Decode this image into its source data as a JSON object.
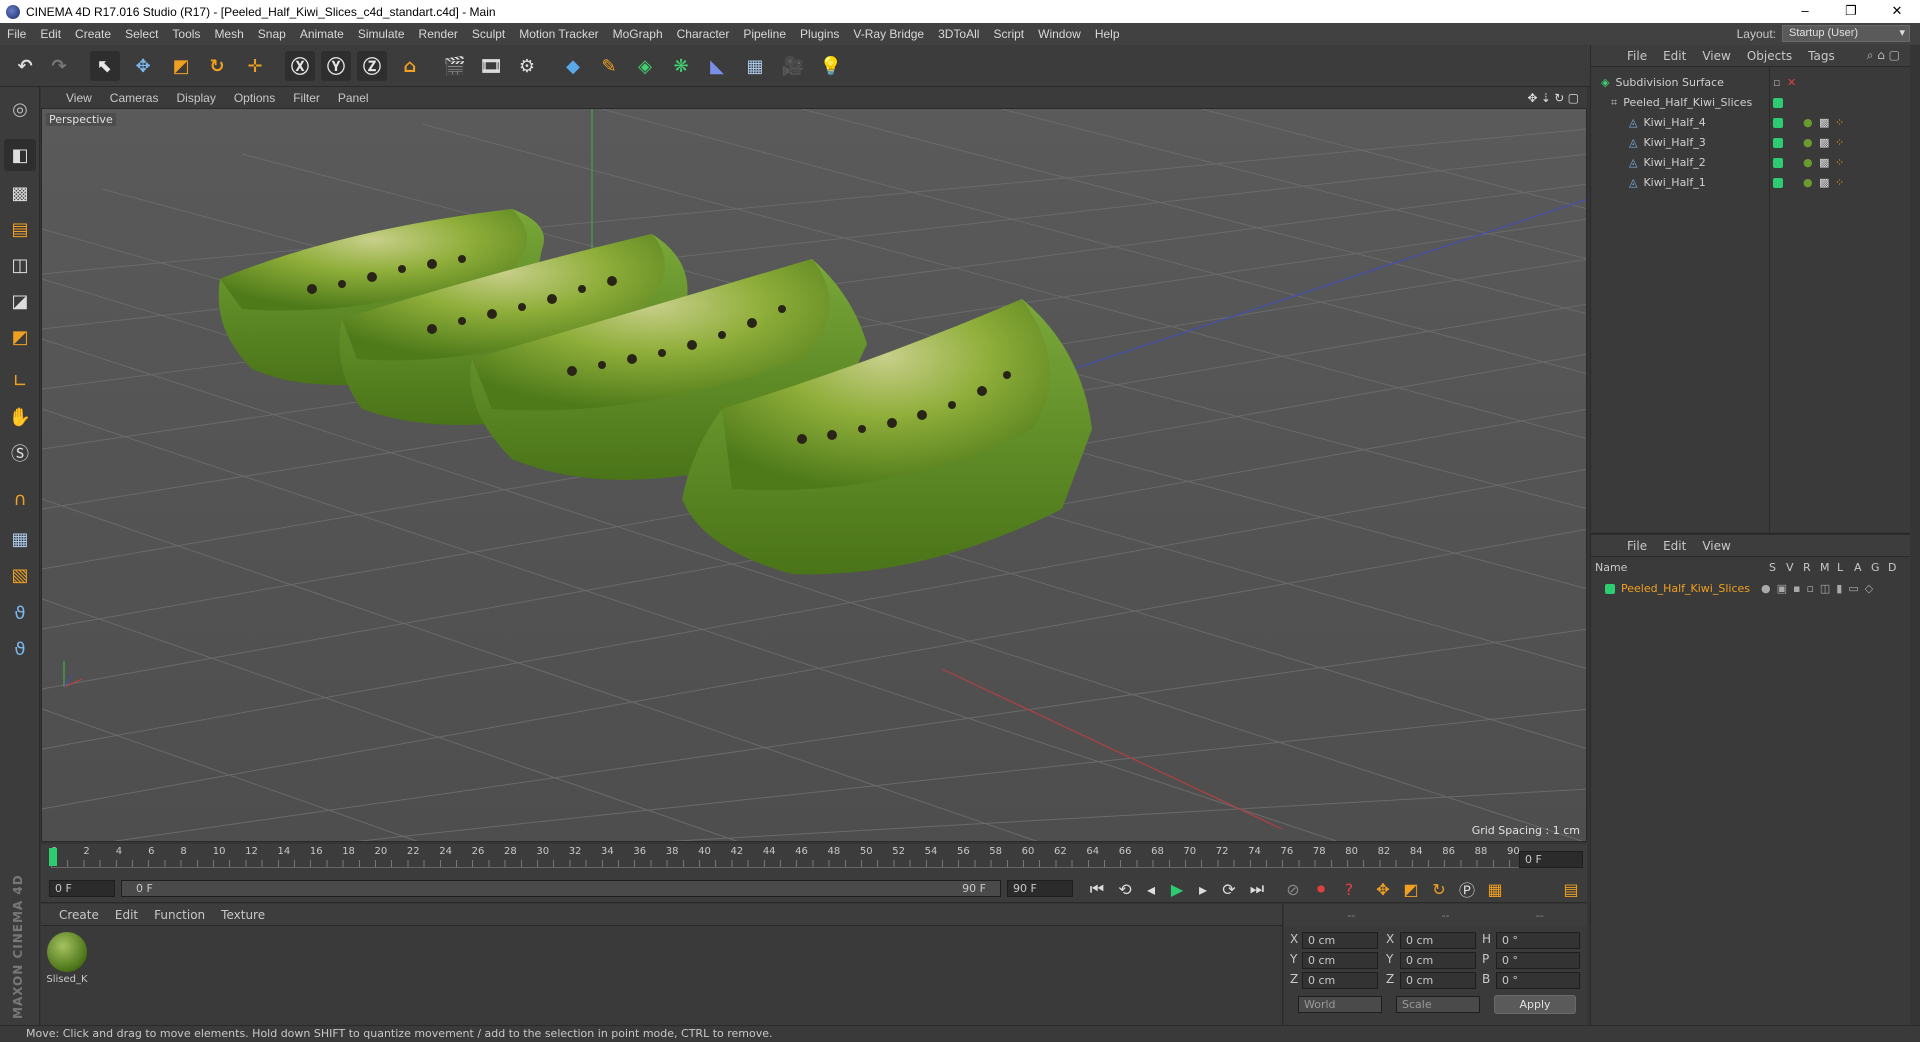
{
  "window": {
    "title": "CINEMA 4D R17.016 Studio (R17) - [Peeled_Half_Kiwi_Slices_c4d_standart.c4d] - Main",
    "minimize": "–",
    "restore": "❐",
    "close": "✕"
  },
  "menu": [
    "File",
    "Edit",
    "Create",
    "Select",
    "Tools",
    "Mesh",
    "Snap",
    "Animate",
    "Simulate",
    "Render",
    "Sculpt",
    "Motion Tracker",
    "MoGraph",
    "Character",
    "Pipeline",
    "Plugins",
    "V-Ray Bridge",
    "3DToAll",
    "Script",
    "Window",
    "Help"
  ],
  "layout": {
    "label": "Layout:",
    "value": "Startup (User)"
  },
  "viewport": {
    "menu": [
      "View",
      "Cameras",
      "Display",
      "Options",
      "Filter",
      "Panel"
    ],
    "camera": "Perspective",
    "grid_spacing": "Grid Spacing : 1 cm"
  },
  "timeline": {
    "ticks": [
      "0",
      "2",
      "4",
      "6",
      "8",
      "10",
      "12",
      "14",
      "16",
      "18",
      "20",
      "22",
      "24",
      "26",
      "28",
      "30",
      "32",
      "34",
      "36",
      "38",
      "40",
      "42",
      "44",
      "46",
      "48",
      "50",
      "52",
      "54",
      "56",
      "58",
      "60",
      "62",
      "64",
      "66",
      "68",
      "70",
      "72",
      "74",
      "76",
      "78",
      "80",
      "82",
      "84",
      "86",
      "88",
      "90"
    ],
    "current_frame": "0 F",
    "start_field": "0 F",
    "range_start": "0 F",
    "range_end": "90 F",
    "end_field": "90 F"
  },
  "materials": {
    "menu": [
      "Create",
      "Edit",
      "Function",
      "Texture"
    ],
    "items": [
      {
        "name": "Slised_K"
      }
    ]
  },
  "coords": {
    "headers": [
      "--",
      "--",
      "--"
    ],
    "rows": [
      {
        "a": "X",
        "av": "0 cm",
        "b": "X",
        "bv": "0 cm",
        "c": "H",
        "cv": "0 °"
      },
      {
        "a": "Y",
        "av": "0 cm",
        "b": "Y",
        "bv": "0 cm",
        "c": "P",
        "cv": "0 °"
      },
      {
        "a": "Z",
        "av": "0 cm",
        "b": "Z",
        "bv": "0 cm",
        "c": "B",
        "cv": "0 °"
      }
    ],
    "mode": "World",
    "transform": "Scale",
    "apply": "Apply"
  },
  "objects_panel": {
    "menu": [
      "File",
      "Edit",
      "View",
      "Objects",
      "Tags"
    ],
    "items": [
      {
        "name": "Subdivision Surface"
      },
      {
        "name": "Peeled_Half_Kiwi_Slices"
      },
      {
        "name": "Kiwi_Half_4"
      },
      {
        "name": "Kiwi_Half_3"
      },
      {
        "name": "Kiwi_Half_2"
      },
      {
        "name": "Kiwi_Half_1"
      }
    ]
  },
  "attributes_panel": {
    "menu": [
      "File",
      "Edit",
      "View"
    ],
    "columns": [
      "Name",
      "S",
      "V",
      "R",
      "M",
      "L",
      "A",
      "G",
      "D"
    ],
    "row": "Peeled_Half_Kiwi_Slices"
  },
  "brand": "MAXON CINEMA 4D",
  "status": "Move: Click and drag to move elements. Hold down SHIFT to quantize movement / add to the selection in point mode, CTRL to remove.",
  "colors": {
    "accent": "#2ecc71",
    "highlight": "#f0a020",
    "axis_x": "#c04040",
    "axis_y": "#40c040",
    "axis_z": "#4050c0"
  }
}
